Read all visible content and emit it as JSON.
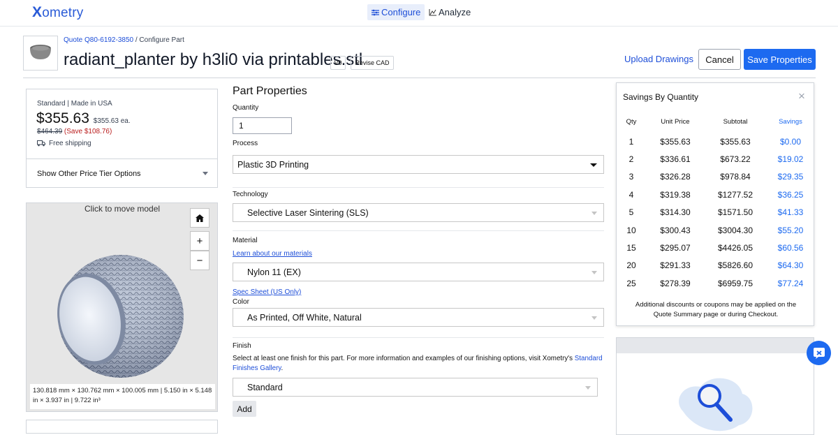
{
  "nav": {
    "logo": "Xometry",
    "tabs": [
      {
        "label": "Configure",
        "icon": "sliders-icon",
        "active": true
      },
      {
        "label": "Analyze",
        "icon": "analyze-chart-icon",
        "active": false
      }
    ]
  },
  "header": {
    "breadcrumb_link": "Quote Q80-6192-3850",
    "breadcrumb_rest": " / Configure Part",
    "title": "radiant_planter by h3li0 via printables.stl",
    "version": "V0",
    "revise": "Revise CAD",
    "upload": "Upload Drawings",
    "cancel": "Cancel",
    "save": "Save Properties"
  },
  "price": {
    "label": "Standard | Made in USA",
    "total": "$355.63",
    "each": "$355.63 ea.",
    "old": "$464.39",
    "save": " (Save $108.76)",
    "shipping": "Free shipping",
    "tier": "Show Other Price Tier Options"
  },
  "viewer": {
    "hint": "Click to move model",
    "home": "home-icon",
    "zoom_in": "+",
    "zoom_out": "−",
    "dims": "130.818 mm × 130.762 mm × 100.005 mm  |  5.150 in × 5.148 in × 3.937 in | 9.722 in³"
  },
  "form": {
    "heading": "Part Properties",
    "quantity_label": "Quantity",
    "quantity_value": "1",
    "process_label": "Process",
    "process_value": "Plastic 3D Printing",
    "technology_label": "Technology",
    "technology_value": "Selective Laser Sintering (SLS)",
    "material_label": "Material",
    "material_link": "Learn about our materials",
    "material_value": "Nylon 11 (EX)",
    "spec_link": "Spec Sheet (US Only)",
    "color_label": "Color",
    "color_value": "As Printed, Off White, Natural",
    "finish_label": "Finish",
    "finish_text": "Select at least one finish for this part. For more information and examples of our finishing options, visit Xometry's ",
    "finish_link": "Standard Finishes Gallery",
    "finish_end": ".",
    "finish_value": "Standard",
    "add": "Add"
  },
  "savings": {
    "title": "Savings By Quantity",
    "headers": [
      "Qty",
      "Unit Price",
      "Subtotal",
      "Savings"
    ],
    "rows": [
      [
        "1",
        "$355.63",
        "$355.63",
        "$0.00"
      ],
      [
        "2",
        "$336.61",
        "$673.22",
        "$19.02"
      ],
      [
        "3",
        "$326.28",
        "$978.84",
        "$29.35"
      ],
      [
        "4",
        "$319.38",
        "$1277.52",
        "$36.25"
      ],
      [
        "5",
        "$314.30",
        "$1571.50",
        "$41.33"
      ],
      [
        "10",
        "$300.43",
        "$3004.30",
        "$55.20"
      ],
      [
        "15",
        "$295.07",
        "$4426.05",
        "$60.56"
      ],
      [
        "20",
        "$291.33",
        "$5826.60",
        "$64.30"
      ],
      [
        "25",
        "$278.39",
        "$6959.75",
        "$77.24"
      ]
    ],
    "footer": "Additional discounts or coupons may be applied on the Quote Summary page or during Checkout."
  },
  "colors": {
    "brand": "#1d6af0",
    "link": "#1d4ed8",
    "save_red": "#b91c1c"
  }
}
